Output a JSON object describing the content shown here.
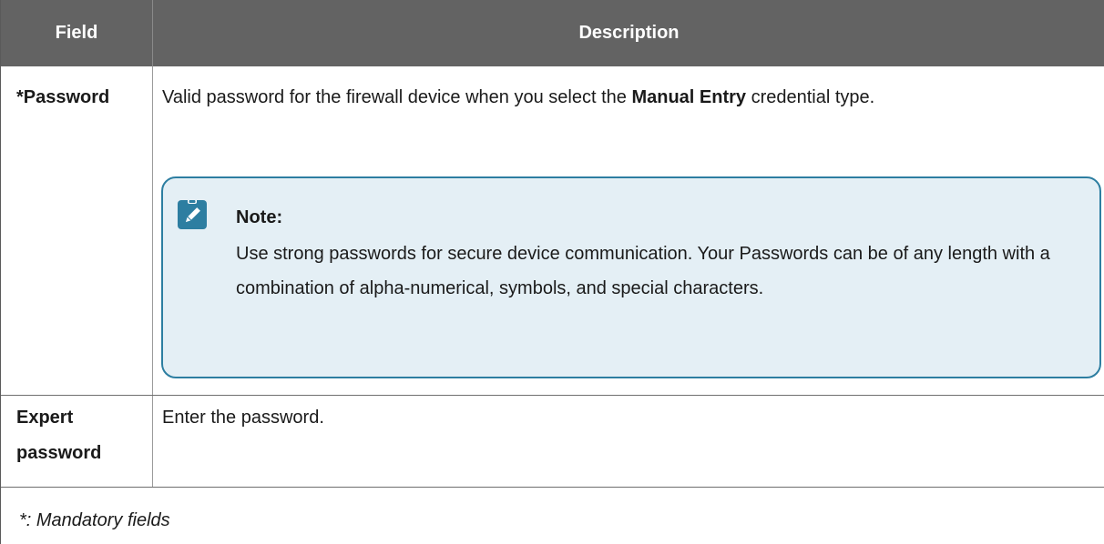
{
  "table": {
    "headers": {
      "field": "Field",
      "description": "Description"
    },
    "rows": [
      {
        "field": "*Password",
        "description_part1": "Valid password for the firewall device when you select the ",
        "description_bold": "Manual Entry",
        "description_part2": " credential type.",
        "note": {
          "icon": "pencil-note-icon",
          "title": "Note:",
          "text": "Use strong passwords for secure device communication. Your Passwords can be of any length with a combination of alpha-numerical, symbols, and special characters."
        }
      },
      {
        "field": "Expert password",
        "description": "Enter the password."
      }
    ],
    "footnote": "*: Mandatory fields"
  },
  "colors": {
    "header_bg": "#636363",
    "note_border": "#2d7ea1",
    "note_bg": "#e4eff5",
    "icon_bg": "#2d7ea1"
  }
}
